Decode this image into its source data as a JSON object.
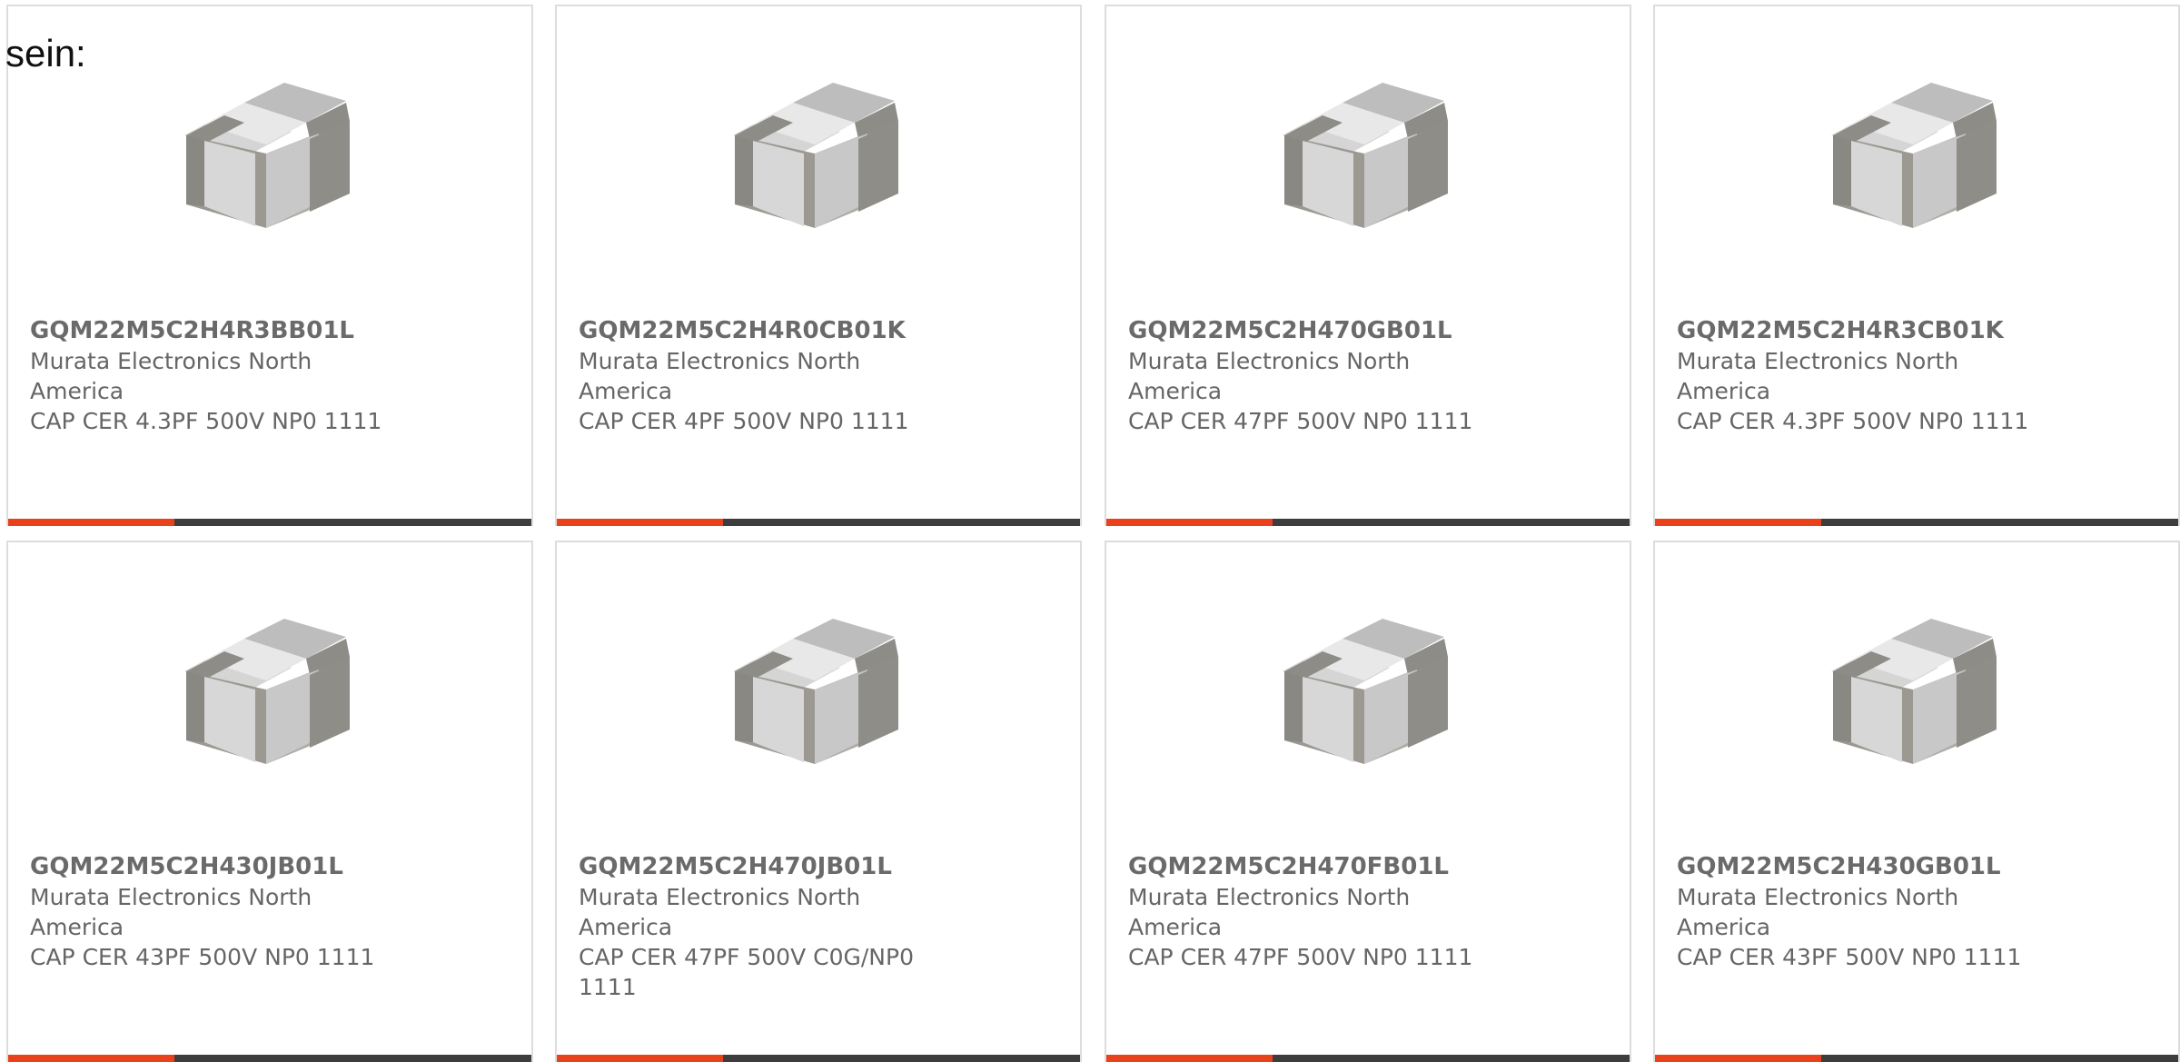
{
  "intro": {
    "text": "sein:"
  },
  "colors": {
    "accent": "#e8411b",
    "bar": "#3d3d3d",
    "border": "#dddddd",
    "text": "#666666"
  },
  "products": [
    {
      "part_number": "GQM22M5C2H4R3BB01L",
      "manufacturer": "Murata Electronics North America",
      "description": "CAP CER 4.3PF 500V NP0 1111",
      "image_icon": "ceramic-capacitor-chip-icon"
    },
    {
      "part_number": "GQM22M5C2H4R0CB01K",
      "manufacturer": "Murata Electronics North America",
      "description": "CAP CER 4PF 500V NP0 1111",
      "image_icon": "ceramic-capacitor-chip-icon"
    },
    {
      "part_number": "GQM22M5C2H470GB01L",
      "manufacturer": "Murata Electronics North America",
      "description": "CAP CER 47PF 500V NP0 1111",
      "image_icon": "ceramic-capacitor-chip-icon"
    },
    {
      "part_number": "GQM22M5C2H4R3CB01K",
      "manufacturer": "Murata Electronics North America",
      "description": "CAP CER 4.3PF 500V NP0 1111",
      "image_icon": "ceramic-capacitor-chip-icon"
    },
    {
      "part_number": "GQM22M5C2H430JB01L",
      "manufacturer": "Murata Electronics North America",
      "description": "CAP CER 43PF 500V NP0 1111",
      "image_icon": "ceramic-capacitor-chip-icon"
    },
    {
      "part_number": "GQM22M5C2H470JB01L",
      "manufacturer": "Murata Electronics North America",
      "description": "CAP CER 47PF 500V C0G/NP0 1111",
      "image_icon": "ceramic-capacitor-chip-icon"
    },
    {
      "part_number": "GQM22M5C2H470FB01L",
      "manufacturer": "Murata Electronics North America",
      "description": "CAP CER 47PF 500V NP0 1111",
      "image_icon": "ceramic-capacitor-chip-icon"
    },
    {
      "part_number": "GQM22M5C2H430GB01L",
      "manufacturer": "Murata Electronics North America",
      "description": "CAP CER 43PF 500V NP0 1111",
      "image_icon": "ceramic-capacitor-chip-icon"
    }
  ]
}
